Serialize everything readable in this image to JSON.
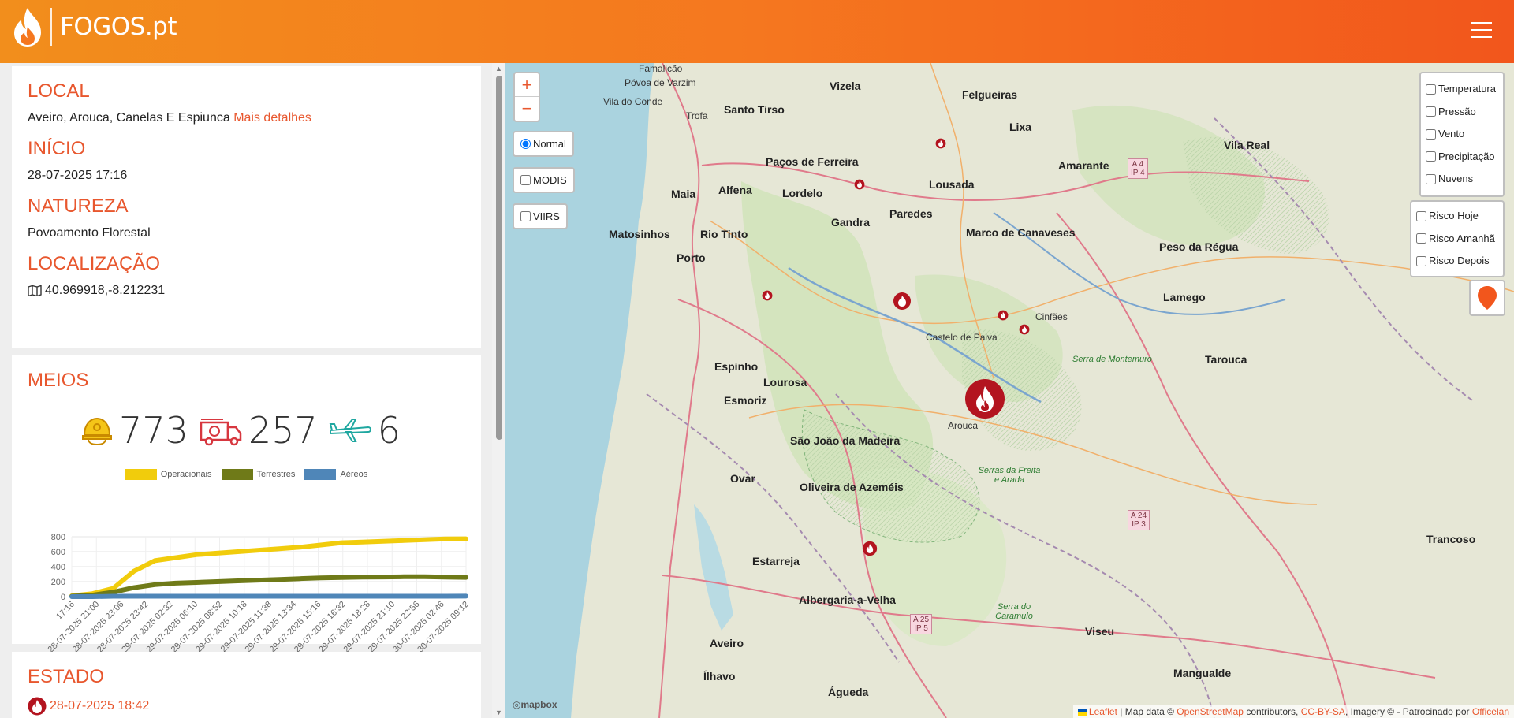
{
  "header": {
    "brand": "FOGOS.pt"
  },
  "info": {
    "local_title": "LOCAL",
    "local_value": "Aveiro, Arouca, Canelas E Espiunca",
    "local_link": "Mais detalhes",
    "inicio_title": "INÍCIO",
    "inicio_value": "28-07-2025 17:16",
    "natureza_title": "NATUREZA",
    "natureza_value": "Povoamento Florestal",
    "localizacao_title": "LOCALIZAÇÃO",
    "localizacao_value": "40.969918,-8.212231"
  },
  "meios": {
    "title": "MEIOS",
    "operacionais": "773",
    "terrestres": "257",
    "aereos": "6"
  },
  "chart_data": {
    "type": "area",
    "series": [
      {
        "name": "Operacionais",
        "color": "#f1cc0c",
        "values": [
          10,
          40,
          110,
          340,
          480,
          520,
          560,
          580,
          600,
          620,
          640,
          660,
          690,
          720,
          730,
          740,
          750,
          760,
          770,
          773
        ]
      },
      {
        "name": "Terrestres",
        "color": "#6f7a18",
        "values": [
          5,
          20,
          60,
          120,
          160,
          180,
          190,
          200,
          210,
          220,
          230,
          240,
          250,
          255,
          260,
          262,
          265,
          265,
          260,
          257
        ]
      },
      {
        "name": "Aéreos",
        "color": "#4f86b8",
        "values": [
          0,
          0,
          5,
          5,
          5,
          5,
          5,
          5,
          5,
          5,
          5,
          5,
          5,
          5,
          5,
          5,
          5,
          5,
          5,
          6
        ]
      }
    ],
    "categories": [
      "17:16",
      "28-07-2025 21:00",
      "28-07-2025 23:06",
      "28-07-2025 23:42",
      "29-07-2025 02:32",
      "29-07-2025 06:10",
      "29-07-2025 08:52",
      "29-07-2025 10:18",
      "29-07-2025 11:38",
      "29-07-2025 13:34",
      "29-07-2025 15:16",
      "29-07-2025 16:32",
      "29-07-2025 18:28",
      "29-07-2025 21:10",
      "29-07-2025 22:56",
      "30-07-2025 02:46",
      "30-07-2025 09:12"
    ],
    "yticks": [
      0,
      200,
      400,
      600,
      800
    ],
    "ylim": [
      0,
      800
    ],
    "legend_position": "top"
  },
  "estado": {
    "title": "ESTADO",
    "timestamp": "28-07-2025 18:42"
  },
  "map": {
    "zoom_in": "+",
    "zoom_out": "−",
    "layers": {
      "normal": "Normal",
      "modis": "MODIS",
      "viirs": "VIIRS"
    },
    "weather": [
      "Temperatura",
      "Pressão",
      "Vento",
      "Precipitação",
      "Nuvens"
    ],
    "risk": [
      "Risco Hoje",
      "Risco Amanhã",
      "Risco Depois"
    ],
    "mapbox": "mapbox",
    "attribution": {
      "leaflet": "Leaflet",
      "sep1": " | Map data © ",
      "osm": "OpenStreetMap",
      "contrib": " contributors, ",
      "license": "CC-BY-SA",
      "imagery": ", Imagery © - Patrocinado por ",
      "sponsor": "Officelan"
    },
    "towns": {
      "famalicao": "Famalicão",
      "povoa": "Póvoa de Varzim",
      "vila_conde": "Vila do Conde",
      "trofa": "Trofa",
      "santo_tirso": "Santo Tirso",
      "vizela": "Vizela",
      "felgueiras": "Felgueiras",
      "lixa": "Lixa",
      "amarante": "Amarante",
      "vila_real": "Vila Real",
      "pacos": "Paços de Ferreira",
      "lousada": "Lousada",
      "maia": "Maia",
      "alfena": "Alfena",
      "lordelo": "Lordelo",
      "paredes": "Paredes",
      "gandra": "Gandra",
      "matosinhos": "Matosinhos",
      "rio_tinto": "Rio Tinto",
      "porto": "Porto",
      "marco": "Marco de Canaveses",
      "peso": "Peso da Régua",
      "lamego": "Lamego",
      "espinho": "Espinho",
      "lourosa": "Lourosa",
      "esmoriz": "Esmoriz",
      "arouca": "Arouca",
      "sao_joao": "São João da Madeira",
      "ovar": "Ovar",
      "oliveira": "Oliveira de Azeméis",
      "estarreja": "Estarreja",
      "albergaria": "Albergaria-a-Velha",
      "aveiro": "Aveiro",
      "ilhavo": "Ílhavo",
      "agueda": "Águeda",
      "viseu": "Viseu",
      "mangualde": "Mangualde",
      "tarouca": "Tarouca",
      "trancoso": "Trancoso",
      "castelo_paiva": "Castelo de Paiva",
      "cinfaes": "Cinfães",
      "serra_montemuro": "Serra de Montemuro",
      "serras_freita": "Serras da Freita e Arada",
      "serra_caramulo": "Serra do Caramulo"
    },
    "shields": {
      "a4": "A 4\nIP 4",
      "a24": "A 24\nIP 3",
      "a25": "A 25\nIP 5"
    }
  }
}
